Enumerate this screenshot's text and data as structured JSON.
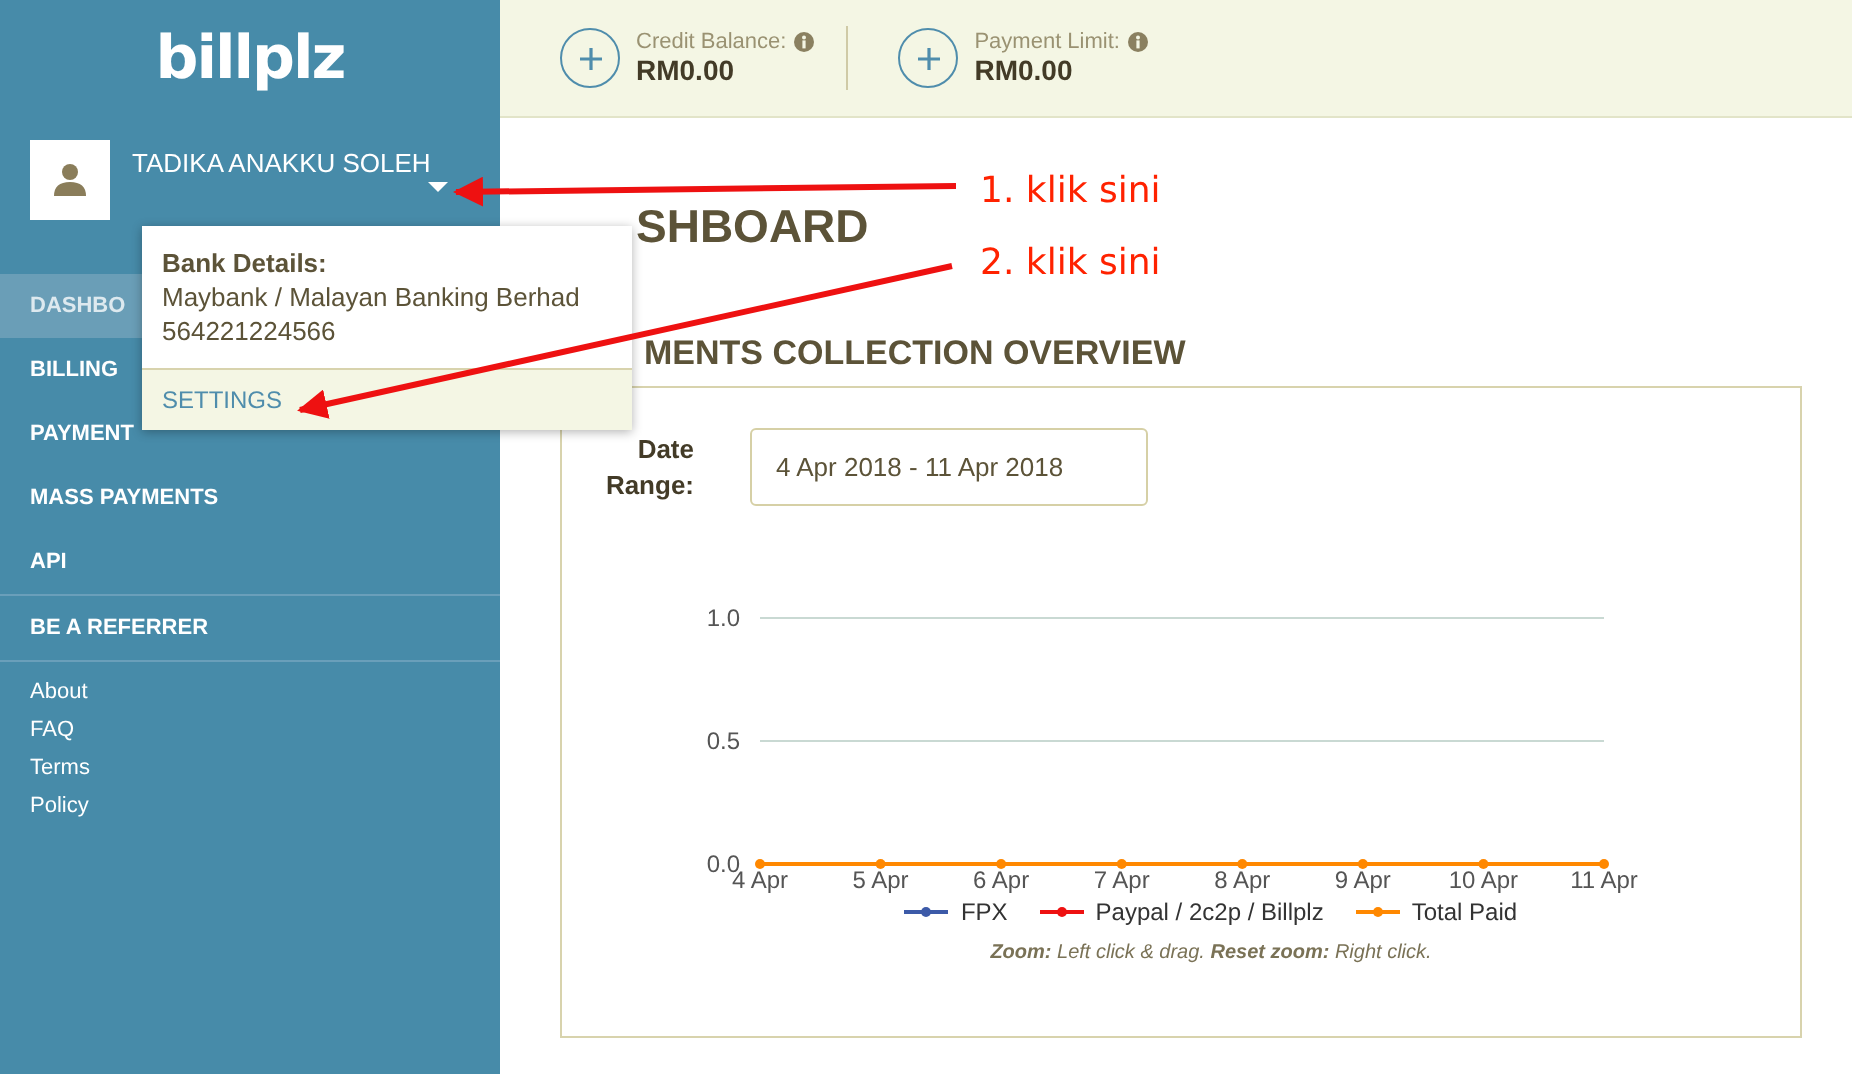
{
  "sidebar": {
    "logo": "billplz",
    "user": {
      "name": "TADIKA ANAKKU SOLEH"
    },
    "nav": [
      {
        "label": "DASHBO",
        "selected": true
      },
      {
        "label": "BILLING",
        "selected": false
      },
      {
        "label": "PAYMENT",
        "selected": false
      },
      {
        "label": "MASS PAYMENTS",
        "selected": false
      },
      {
        "label": "API",
        "selected": false
      }
    ],
    "referrer": "BE A REFERRER",
    "footer_links": [
      "About",
      "FAQ",
      "Terms",
      "Policy"
    ]
  },
  "user_menu": {
    "heading": "Bank Details:",
    "bank": "Maybank / Malayan Banking Berhad",
    "account": "564221224566",
    "settings": "SETTINGS"
  },
  "top_bar": {
    "stats": [
      {
        "label": "Credit Balance:",
        "value": "RM0.00"
      },
      {
        "label": "Payment Limit:",
        "value": "RM0.00"
      }
    ]
  },
  "page_title": "SHBOARD",
  "section_title": "MENTS COLLECTION OVERVIEW",
  "date_range": {
    "label": "Date Range:",
    "value": "4 Apr 2018 - 11 Apr 2018"
  },
  "chart_data": {
    "type": "line",
    "categories": [
      "4 Apr",
      "5 Apr",
      "6 Apr",
      "7 Apr",
      "8 Apr",
      "9 Apr",
      "10 Apr",
      "11 Apr"
    ],
    "series": [
      {
        "name": "FPX",
        "color": "#3c5aa8",
        "marker": true,
        "values": [
          null,
          null,
          null,
          null,
          null,
          null,
          null,
          null
        ]
      },
      {
        "name": "Paypal / 2c2p / Billplz",
        "color": "#ee1111",
        "marker": true,
        "values": [
          null,
          null,
          null,
          null,
          null,
          null,
          null,
          null
        ]
      },
      {
        "name": "Total Paid",
        "color": "#ff8800",
        "marker": true,
        "values": [
          0,
          0,
          0,
          0,
          0,
          0,
          0,
          0
        ]
      }
    ],
    "ylim": [
      0,
      1
    ],
    "yticks": [
      {
        "value": 0,
        "label": "0.0"
      },
      {
        "value": 0.5,
        "label": "0.5"
      },
      {
        "value": 1,
        "label": "1.0"
      }
    ]
  },
  "chart_note": "**Zoom:** Left click & drag. **Reset zoom:** Right click.",
  "annotations": [
    {
      "label": "1. klik sini"
    },
    {
      "label": "2. klik sini"
    }
  ]
}
